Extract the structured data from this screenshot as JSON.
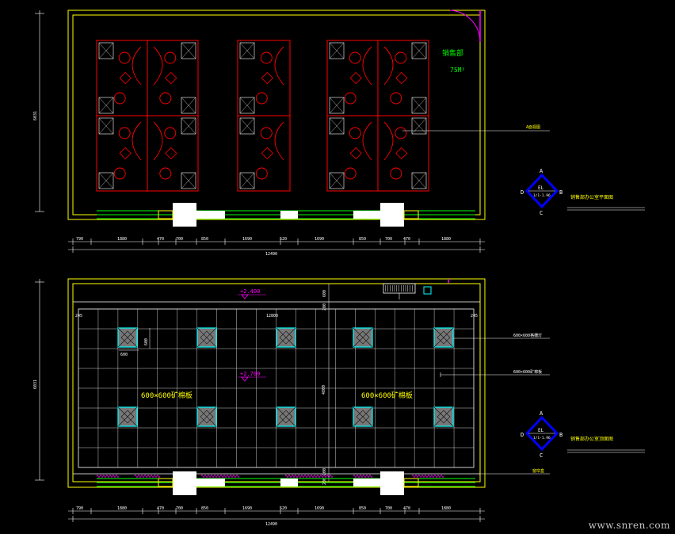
{
  "colors": {
    "background": "#000000",
    "wall": "#ffff00",
    "furniture": "#ff0000",
    "dimension": "#ffffff",
    "ceiling_grid": "#ffffff",
    "light_fixture": "#00ffff",
    "label_green": "#00ff00",
    "label_yellow": "#ffff00",
    "marker_blue": "#0000ff",
    "window": "#00ff00",
    "door": "#ff00ff"
  },
  "plan": {
    "room_name": "销售部",
    "room_area": "75M²",
    "callout_label": "A面视图",
    "height_dimension": "6031",
    "top_dimensions": [
      "790",
      "1880",
      "470",
      "700",
      "850",
      "1690",
      "520",
      "1690",
      "850",
      "700",
      "470",
      "1880"
    ],
    "total_dimension": "12490",
    "index_marker": {
      "top": "A",
      "left": "D",
      "right": "B",
      "bottom": "C",
      "center_top": "EL",
      "center_bottom": "1/1-1.96"
    },
    "index_caption": "销售部办公室平面图"
  },
  "ceiling": {
    "level_top": "+2.400",
    "level_mid": "+2.700",
    "span_label": "12800",
    "height_label": "4800",
    "edge_left": "245",
    "edge_right": "245",
    "tile_small_v": "600",
    "tile_small_h": "600",
    "vertical_dims": [
      "200",
      "600",
      "200",
      "200"
    ],
    "ceiling_label_left": "600×600矿棉板",
    "ceiling_label_right": "600×600矿棉板",
    "callouts": [
      "600×600格栅灯",
      "600×600矿棉板",
      "窗帘盒"
    ],
    "height_dimension": "6031",
    "top_dimensions": [
      "790",
      "1880",
      "470",
      "700",
      "850",
      "1690",
      "520",
      "1690",
      "850",
      "700",
      "470",
      "1880"
    ],
    "total_dimension": "12490",
    "index_marker": {
      "top": "A",
      "left": "D",
      "right": "B",
      "bottom": "C",
      "center_top": "EL",
      "center_bottom": "1/1-1.96"
    },
    "index_caption": "销售部办公室顶面图"
  },
  "watermark": "www.snren.com"
}
